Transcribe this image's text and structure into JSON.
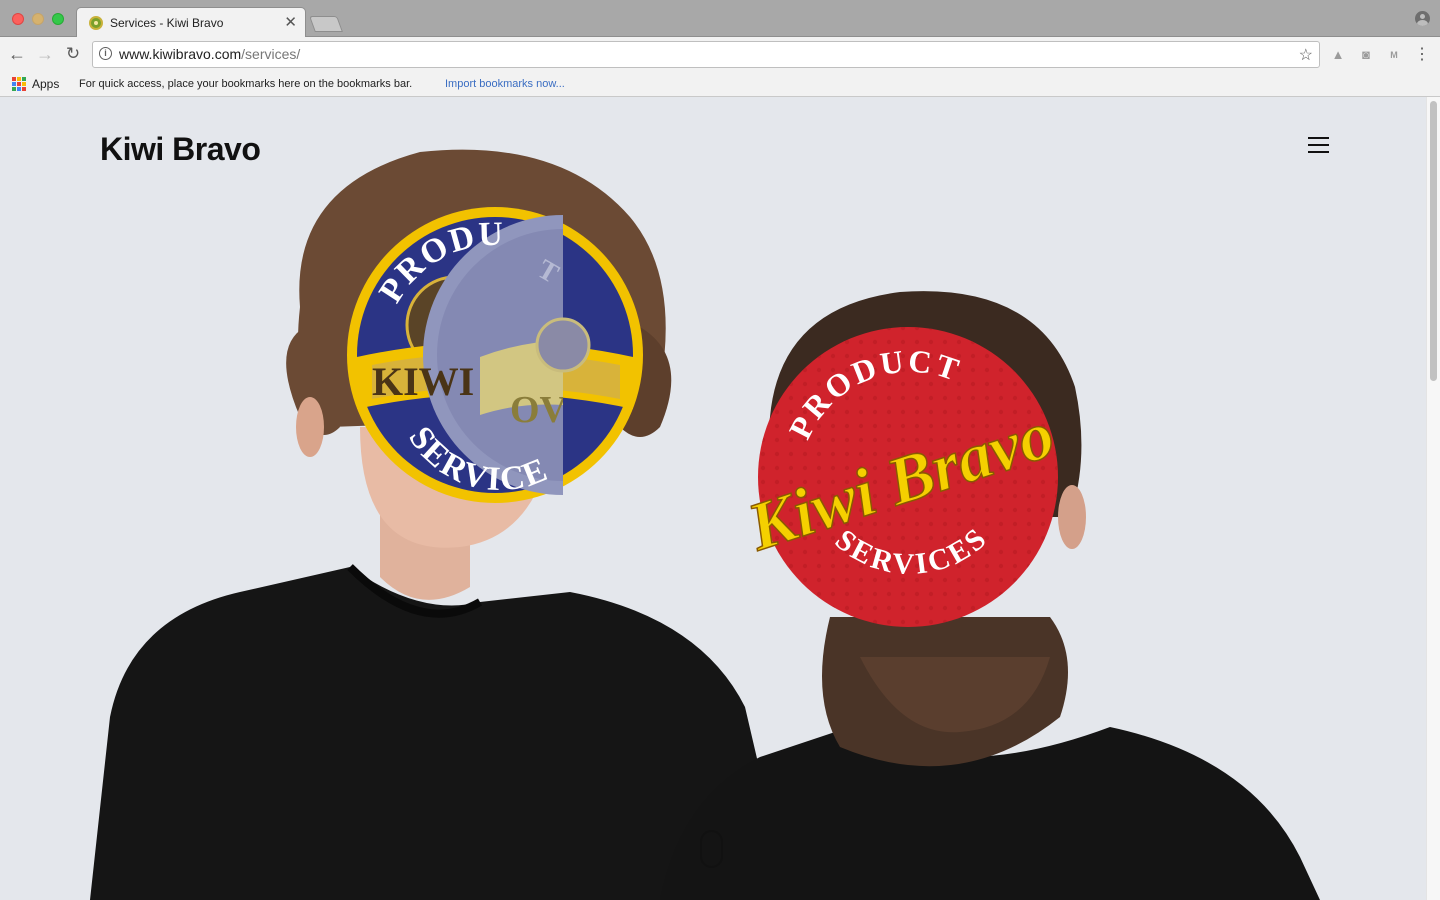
{
  "browser": {
    "tab_title": "Services - Kiwi Bravo",
    "tab_close": "✕",
    "url_host": "www.kiwibravo.com",
    "url_path": "/services/",
    "back_icon": "←",
    "forward_icon": "→",
    "reload_icon": "↻",
    "star_icon": "☆",
    "menu_icon": "⋮",
    "ext_drive": "▲",
    "ext_camera": "◙",
    "ext_mx": "M",
    "bookmarks": {
      "apps_label": "Apps",
      "hint": "For quick access, place your bookmarks here on the bookmarks bar.",
      "import_link": "Import bookmarks now..."
    }
  },
  "page": {
    "brand": "Kiwi Bravo",
    "badge_left": {
      "top": "PRODU",
      "middle": "KIWI",
      "bottom": "SERVICE",
      "overlay_top": "T",
      "overlay_middle": "OV"
    },
    "badge_right": {
      "top": "PRODUCT",
      "script": "Kiwi Bravo",
      "bottom": "SERVICES"
    }
  },
  "colors": {
    "page_bg": "#e4e7ec",
    "badge_navy": "#2b3485",
    "badge_gold": "#f2c200",
    "badge_red": "#d0232c",
    "badge_script": "#f5d000"
  }
}
